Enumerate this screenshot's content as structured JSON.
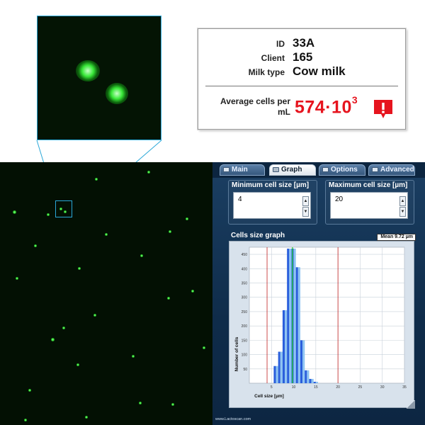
{
  "zoom_inset": {
    "icon": "microscope-zoom"
  },
  "info": {
    "id_label": "ID",
    "id_value": "33A",
    "client_label": "Client",
    "client_value": "165",
    "milk_label": "Milk type",
    "milk_value": "Cow milk",
    "avg_label_line1": "Average cells per",
    "avg_label_line2": "mL",
    "avg_value_base": "574·10",
    "avg_value_exp": "3",
    "alert_icon": "exclamation-alert-icon",
    "alert_color": "#e6141e"
  },
  "tabs": [
    {
      "label": "Main",
      "icon": "window-icon"
    },
    {
      "label": "Graph",
      "icon": "chart-icon",
      "active": true
    },
    {
      "label": "Options",
      "icon": "gear-icon"
    },
    {
      "label": "Advanced",
      "icon": "lock-icon"
    }
  ],
  "min_cell": {
    "label": "Minimum cell size [µm]",
    "value": "4"
  },
  "max_cell": {
    "label": "Maximum cell size [µm]",
    "value": "20"
  },
  "graph": {
    "title": "Cells size graph",
    "mean_label": "Mean 9.72 µm",
    "ylabel": "Number of cells",
    "xlabel": "Cell size [µm]"
  },
  "chart_data": {
    "type": "bar",
    "title": "Cells size graph",
    "xlabel": "Cell size [µm]",
    "ylabel": "Number of cells",
    "xlim": [
      0,
      35
    ],
    "ylim": [
      0,
      475
    ],
    "xticks": [
      5,
      10,
      15,
      20,
      25,
      30,
      35
    ],
    "yticks": [
      50,
      100,
      150,
      200,
      250,
      300,
      350,
      400,
      450
    ],
    "bin_width": 1,
    "bins_x": [
      6,
      7,
      8,
      9,
      10,
      11,
      12,
      13,
      14,
      15
    ],
    "bins_y": [
      60,
      110,
      255,
      470,
      470,
      405,
      150,
      45,
      15,
      5
    ],
    "threshold_lines_x": [
      4,
      20
    ],
    "mean_line_x": 9.72,
    "colors": {
      "bar_dark": "#2a5fdc",
      "bar_light": "#8ec4f2",
      "threshold": "#c02020",
      "mean": "#20d020"
    }
  },
  "footer": "www.Lactoscan.com"
}
